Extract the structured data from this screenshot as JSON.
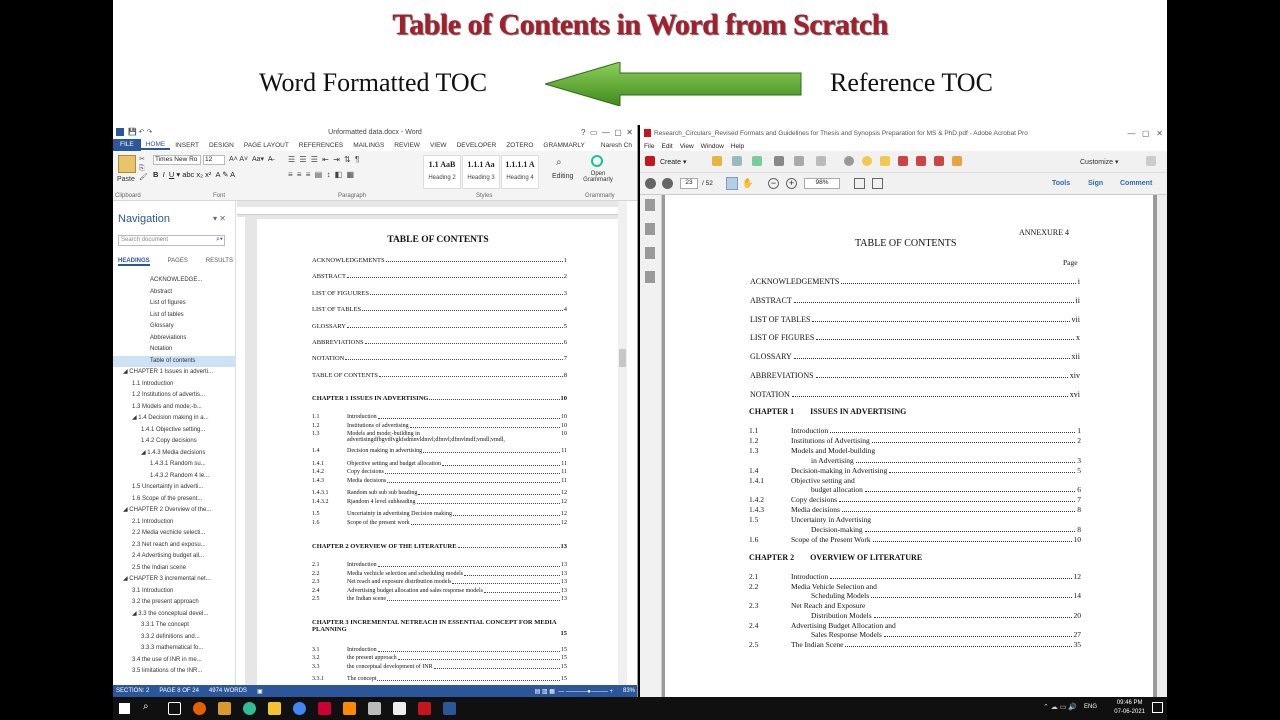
{
  "banner": {
    "title": "Table of Contents in Word from Scratch",
    "left_label": "Word Formatted TOC",
    "right_label": "Reference TOC",
    "arrow_color": "#4e9a2a",
    "title_color": "#a81d2a"
  },
  "word": {
    "window_title": "Unformatted data.docx - Word",
    "user": "Naresh Ch",
    "tabs": [
      "FILE",
      "HOME",
      "INSERT",
      "DESIGN",
      "PAGE LAYOUT",
      "REFERENCES",
      "MAILINGS",
      "REVIEW",
      "VIEW",
      "DEVELOPER",
      "ZOTERO",
      "GRAMMARLY"
    ],
    "ribbon": {
      "paste": "Paste",
      "font_name": "Times New Ro",
      "font_size": "12",
      "styles": [
        {
          "preview": "1.1 AaB",
          "name": "Heading 2"
        },
        {
          "preview": "1.1.1 Aa",
          "name": "Heading 3"
        },
        {
          "preview": "1.1.1.1 A",
          "name": "Heading 4"
        }
      ],
      "editing": "Editing",
      "open_grammarly": "Open Grammarly",
      "groups": {
        "clipboard": "Clipboard",
        "font": "Font",
        "paragraph": "Paragraph",
        "styles": "Styles",
        "grammarly": "Grammarly"
      }
    },
    "navigation": {
      "title": "Navigation",
      "search_placeholder": "Search document",
      "tabs": [
        "HEADINGS",
        "PAGES",
        "RESULTS"
      ],
      "items": [
        {
          "label": "ACKNOWLEDGE...",
          "indent": 3,
          "selected": false
        },
        {
          "label": "Abstract",
          "indent": 3,
          "selected": false
        },
        {
          "label": "List of figures",
          "indent": 3,
          "selected": false
        },
        {
          "label": "List of tables",
          "indent": 3,
          "selected": false
        },
        {
          "label": "Glossary",
          "indent": 3,
          "selected": false
        },
        {
          "label": "Abbreviations",
          "indent": 3,
          "selected": false
        },
        {
          "label": "Notation",
          "indent": 3,
          "selected": false
        },
        {
          "label": "Table of contents",
          "indent": 3,
          "selected": true
        },
        {
          "label": "◢ CHAPTER 1 Issues in adverti...",
          "indent": 0,
          "selected": false
        },
        {
          "label": "1.1 Introduction",
          "indent": 1,
          "selected": false
        },
        {
          "label": "1.2 Institutions of advertis...",
          "indent": 1,
          "selected": false
        },
        {
          "label": "1.3 Models and mode;-b...",
          "indent": 1,
          "selected": false
        },
        {
          "label": "◢ 1.4 Decision making in a...",
          "indent": 1,
          "selected": false
        },
        {
          "label": "1.4.1 Objective setting...",
          "indent": 2,
          "selected": false
        },
        {
          "label": "1.4.2 Copy decisions",
          "indent": 2,
          "selected": false
        },
        {
          "label": "◢ 1.4.3 Media decisions",
          "indent": 2,
          "selected": false
        },
        {
          "label": "1.4.3.1 Random su...",
          "indent": 3,
          "selected": false
        },
        {
          "label": "1.4.3.2 Random 4 le...",
          "indent": 3,
          "selected": false
        },
        {
          "label": "1.5 Uncertainty in adverti...",
          "indent": 1,
          "selected": false
        },
        {
          "label": "1.6 Scope of the present...",
          "indent": 1,
          "selected": false
        },
        {
          "label": "◢ CHAPTER 2 Overview of the...",
          "indent": 0,
          "selected": false
        },
        {
          "label": "2.1 Introduction",
          "indent": 1,
          "selected": false
        },
        {
          "label": "2.2 Media vechicle selecti...",
          "indent": 1,
          "selected": false
        },
        {
          "label": "2.3 Net reach and exposu...",
          "indent": 1,
          "selected": false
        },
        {
          "label": "2.4 Advertising budget all...",
          "indent": 1,
          "selected": false
        },
        {
          "label": "2.5 the Indian scene",
          "indent": 1,
          "selected": false
        },
        {
          "label": "◢ CHAPTER 3 incremental net...",
          "indent": 0,
          "selected": false
        },
        {
          "label": "3.1 Introduction",
          "indent": 1,
          "selected": false
        },
        {
          "label": "3.2 the present approach",
          "indent": 1,
          "selected": false
        },
        {
          "label": "◢ 3.3 the conceptual devel...",
          "indent": 1,
          "selected": false
        },
        {
          "label": "3.3.1 The concept",
          "indent": 2,
          "selected": false
        },
        {
          "label": "3.3.2 definitions and...",
          "indent": 2,
          "selected": false
        },
        {
          "label": "3.3.3 mathematical fo...",
          "indent": 2,
          "selected": false
        },
        {
          "label": "3.4 the use of INR in me...",
          "indent": 1,
          "selected": false
        },
        {
          "label": "3.5 limitations of the INR...",
          "indent": 1,
          "selected": false
        }
      ]
    },
    "document": {
      "title": "TABLE OF CONTENTS",
      "front_matter": [
        {
          "text": "ACKNOWLEDGEMENTS",
          "page": "1"
        },
        {
          "text": "ABSTRACT",
          "page": "2"
        },
        {
          "text": "LIST OF FIGUURES",
          "page": "3"
        },
        {
          "text": "LIST OF TABLES",
          "page": "4"
        },
        {
          "text": "GLOSSARY",
          "page": "5"
        },
        {
          "text": "ABBREVIATIONS",
          "page": "6"
        },
        {
          "text": "NOTATION",
          "page": "7"
        },
        {
          "text": "TABLE OF CONTENTS",
          "page": "8"
        }
      ],
      "chapters": [
        {
          "heading": "CHAPTER 1      ISSUES IN ADVERTISING",
          "page": "10",
          "groups": [
            [
              {
                "num": "1.1",
                "text": "Introduction",
                "page": "10"
              },
              {
                "num": "1.2",
                "text": "Institutions of advertising",
                "page": "10"
              },
              {
                "num": "1.3",
                "text": "Models and mode;-building in advertisingdfbgvdfvgkfsdmnvldmvl;dfmvl;dfmvlmdf;vmdl;vmdl,",
                "page": "10"
              },
              {
                "num": "1.4",
                "text": "Decision making in advertising",
                "page": "11"
              }
            ],
            [
              {
                "num": "1.4.1",
                "text": "Objective setting and budget allocation",
                "page": "11"
              },
              {
                "num": "1.4.2",
                "text": "Copy decisions",
                "page": "11"
              },
              {
                "num": "1.4.3",
                "text": "Media decisions",
                "page": "11"
              }
            ],
            [
              {
                "num": "1.4.3.1",
                "text": "Random sub sub sub heading",
                "page": "12"
              },
              {
                "num": "1.4.3.2",
                "text": "Rjandom 4 level subheading",
                "page": "12"
              }
            ],
            [
              {
                "num": "1.5",
                "text": "Uncertainty in advertising Decision making",
                "page": "12"
              },
              {
                "num": "1.6",
                "text": "Scope of the present work",
                "page": "12"
              }
            ]
          ]
        },
        {
          "heading": "CHAPTER 2      OVERVIEW OF THE LITERATURE",
          "page": "13",
          "groups": [
            [
              {
                "num": "2.1",
                "text": "Introduction",
                "page": "13"
              },
              {
                "num": "2.2",
                "text": "Media vechicle selection and scheduling models",
                "page": "13"
              },
              {
                "num": "2.3",
                "text": "Net reach and exposure distribution models",
                "page": "13"
              },
              {
                "num": "2.4",
                "text": "Advertising budget allocation and sales response models",
                "page": "13"
              },
              {
                "num": "2.5",
                "text": "the Indian scene",
                "page": "13"
              }
            ]
          ]
        },
        {
          "heading": "CHAPTER 3      INCREMENTAL NETREACH IN ESSENTIAL CONCEPT FOR MEDIA PLANNING",
          "page": "15",
          "groups": [
            [
              {
                "num": "3.1",
                "text": "Introduction",
                "page": "15"
              },
              {
                "num": "3.2",
                "text": "the present approach",
                "page": "15"
              },
              {
                "num": "3.3",
                "text": "the conceptual development of INR",
                "page": "15"
              }
            ],
            [
              {
                "num": "3.3.1",
                "text": "The concept",
                "page": "15"
              }
            ]
          ]
        }
      ]
    },
    "status": {
      "section": "SECTION: 2",
      "page": "PAGE 8 OF 24",
      "words": "4974 WORDS",
      "zoom": "83%"
    }
  },
  "acrobat": {
    "window_title": "Research_Circulars_Revised Formats and Guidelines for Thesis and Synopsis Preparation for MS & PhD.pdf - Adobe Acrobat Pro",
    "menu": [
      "File",
      "Edit",
      "View",
      "Window",
      "Help"
    ],
    "create": "Create",
    "customize": "Customize",
    "page_current": "23",
    "page_total": "/ 52",
    "zoom": "98%",
    "right_links": [
      "Tools",
      "Sign",
      "Comment"
    ],
    "doc": {
      "annexure": "ANNEXURE 4",
      "title": "TABLE OF CONTENTS",
      "page_label": "Page",
      "front_matter": [
        {
          "text": "ACKNOWLEDGEMENTS",
          "page": "i"
        },
        {
          "text": "ABSTRACT",
          "page": "ii"
        },
        {
          "text": "LIST OF TABLES",
          "page": "vii"
        },
        {
          "text": "LIST OF FIGURES",
          "page": "x"
        },
        {
          "text": "GLOSSARY",
          "page": "xii"
        },
        {
          "text": "ABBREVIATIONS",
          "page": "xiv"
        },
        {
          "text": "NOTATION",
          "page": "xvi"
        }
      ],
      "ch1_heading": "CHAPTER 1        ISSUES IN ADVERTISING",
      "ch1_items": [
        {
          "num": "1.1",
          "text": "Introduction",
          "text2": "",
          "page": "1"
        },
        {
          "num": "1.2",
          "text": "Institutions of Advertising",
          "text2": "",
          "page": "2"
        },
        {
          "num": "1.3",
          "text": "Models and Model-building",
          "text2": "in Advertising",
          "page": "3"
        },
        {
          "num": "1.4",
          "text": "Decision-making in Advertising",
          "text2": "",
          "page": "5"
        },
        {
          "num": "1.4.1",
          "text": "Objective setting and",
          "text2": "budget allocation",
          "page": "6"
        },
        {
          "num": "1.4.2",
          "text": "Copy decisions",
          "text2": "",
          "page": "7"
        },
        {
          "num": "1.4.3",
          "text": "Media decisions",
          "text2": "",
          "page": "8"
        },
        {
          "num": "1.5",
          "text": "Uncertainty in Advertising",
          "text2": "Decision-making",
          "page": "8"
        },
        {
          "num": "1.6",
          "text": "Scope of the Present Work",
          "text2": "",
          "page": "10"
        }
      ],
      "ch2_heading": "CHAPTER 2        OVERVIEW OF LITERATURE",
      "ch2_items": [
        {
          "num": "2.1",
          "text": "Introduction",
          "text2": "",
          "page": "12"
        },
        {
          "num": "2.2",
          "text": "Media Vehicle Selection and",
          "text2": "Scheduling Models",
          "page": "14"
        },
        {
          "num": "2.3",
          "text": "Net Reach and Exposure",
          "text2": "Distribution Models",
          "page": "20"
        },
        {
          "num": "2.4",
          "text": "Advertising Budget Allocation and",
          "text2": "Sales Response Models",
          "page": "27"
        },
        {
          "num": "2.5",
          "text": "The Indian Scene",
          "text2": "",
          "page": "35"
        }
      ]
    }
  },
  "taskbar": {
    "language": "ENG",
    "time": "09:46 PM",
    "date": "07-06-2021"
  }
}
